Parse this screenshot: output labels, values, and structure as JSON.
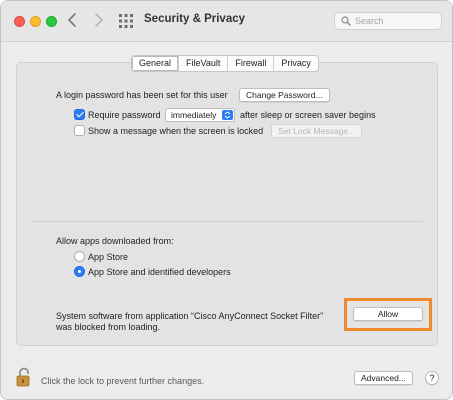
{
  "window": {
    "title": "Security & Privacy"
  },
  "search": {
    "placeholder": "Search"
  },
  "tabs": [
    {
      "label": "General",
      "active": true
    },
    {
      "label": "FileVault",
      "active": false
    },
    {
      "label": "Firewall",
      "active": false
    },
    {
      "label": "Privacy",
      "active": false
    }
  ],
  "general": {
    "login_password_text": "A login password has been set for this user",
    "change_password_label": "Change Password...",
    "require_password": {
      "label": "Require password",
      "checked": true,
      "selected_option": "immediately",
      "suffix": "after sleep or screen saver begins"
    },
    "show_message": {
      "label": "Show a message when the screen is locked",
      "checked": false
    },
    "set_lock_message_label": "Set Lock Message..."
  },
  "allow_apps": {
    "heading": "Allow apps downloaded from:",
    "options": [
      {
        "label": "App Store",
        "selected": false
      },
      {
        "label": "App Store and identified developers",
        "selected": true
      }
    ]
  },
  "blocked_software": {
    "line1": "System software from application “Cisco AnyConnect Socket Filter”",
    "line2": "was blocked from loading.",
    "allow_label": "Allow"
  },
  "footer": {
    "lock_text": "Click the lock to prevent further changes.",
    "advanced_label": "Advanced...",
    "help_label": "?"
  },
  "colors": {
    "accent": "#2b7cf5",
    "highlight": "#f0882e"
  },
  "icons": {
    "back": "chevron-left-icon",
    "forward": "chevron-right-icon",
    "show_all": "grid-icon",
    "search": "search-icon",
    "lock": "lock-icon"
  }
}
